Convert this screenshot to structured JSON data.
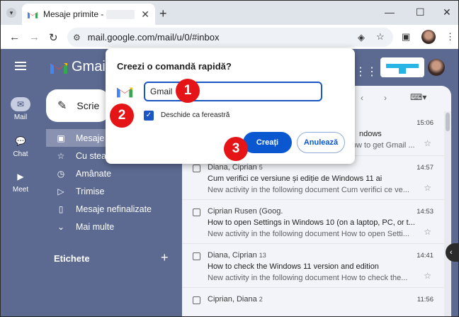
{
  "browser": {
    "tab_title": "Mesaje primite -",
    "omnibox_url": "mail.google.com/mail/u/0/#inbox"
  },
  "gmail": {
    "logo_text": "Gmail",
    "compose_label": "Scrie",
    "rail": {
      "mail": "Mail",
      "chat": "Chat",
      "meet": "Meet"
    },
    "nav": [
      {
        "label": "Mesaje primite",
        "active": true
      },
      {
        "label": "Cu stea"
      },
      {
        "label": "Amânate"
      },
      {
        "label": "Trimise"
      },
      {
        "label": "Mesaje nefinalizate"
      },
      {
        "label": "Mai multe"
      }
    ],
    "labels_heading": "Etichete",
    "emails": [
      {
        "sender": "",
        "count": "",
        "subject": "ndows",
        "snippet": "How to get Gmail ...",
        "time": "15:06"
      },
      {
        "sender": "Diana, Ciprian",
        "count": "5",
        "subject": "Cum verifici ce versiune și ediție de Windows 11 ai",
        "snippet": "New activity in the following document Cum verifici ce ve...",
        "time": "14:57"
      },
      {
        "sender": "Ciprian Rusen (Goog.",
        "count": "",
        "subject": "How to open Settings in Windows 10 (on a laptop, PC, or t...",
        "snippet": "New activity in the following document How to open Setti...",
        "time": "14:53"
      },
      {
        "sender": "Diana, Ciprian",
        "count": "13",
        "subject": "How to check the Windows 11 version and edition",
        "snippet": "New activity in the following document How to check the...",
        "time": "14:41"
      },
      {
        "sender": "Ciprian, Diana",
        "count": "2",
        "subject": "",
        "snippet": "",
        "time": "11:56"
      }
    ]
  },
  "dialog": {
    "title": "Creezi o comandă rapidă?",
    "name_value": "Gmail",
    "open_as_window_label": "Deschide ca fereastră",
    "open_as_window_checked": true,
    "create_button": "Creați",
    "cancel_button": "Anulează"
  },
  "annotations": [
    "1",
    "2",
    "3"
  ],
  "colors": {
    "badge": "#e51416",
    "primary_button": "#0b57d0",
    "gmail_background": "#5c6a91"
  }
}
